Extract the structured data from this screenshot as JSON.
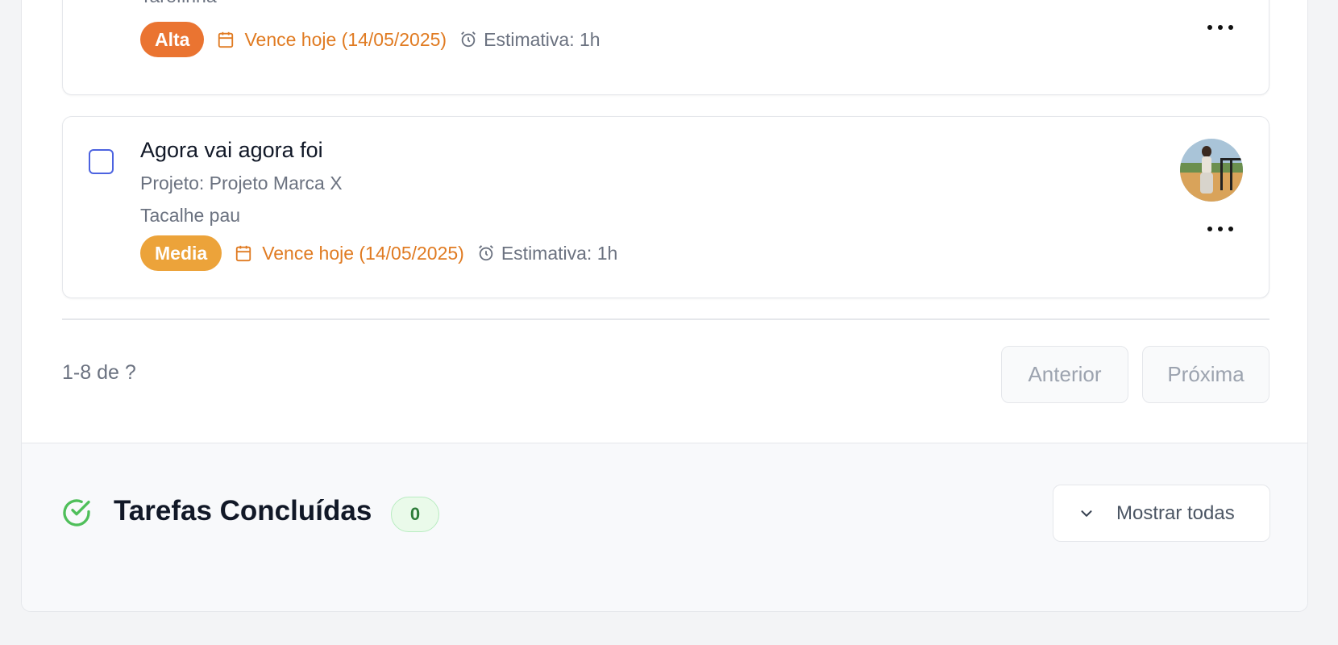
{
  "tasks": [
    {
      "description": "Tarefinha",
      "priority": "Alta",
      "priority_color": "#ea7431",
      "due": "Vence hoje (14/05/2025)",
      "estimate": "Estimativa: 1h"
    },
    {
      "title": "Agora vai agora foi",
      "project": "Projeto: Projeto Marca X",
      "description": "Tacalhe pau",
      "priority": "Media",
      "priority_color": "#eca33a",
      "due": "Vence hoje (14/05/2025)",
      "estimate": "Estimativa: 1h"
    }
  ],
  "pagination": {
    "range": "1-8 de ?",
    "prev_label": "Anterior",
    "next_label": "Próxima"
  },
  "completed": {
    "title": "Tarefas Concluídas",
    "count": "0",
    "toggle_label": "Mostrar todas"
  },
  "colors": {
    "due_text": "#e07b22",
    "checkbox_border": "#4c63e0",
    "success": "#4fbf5a"
  }
}
